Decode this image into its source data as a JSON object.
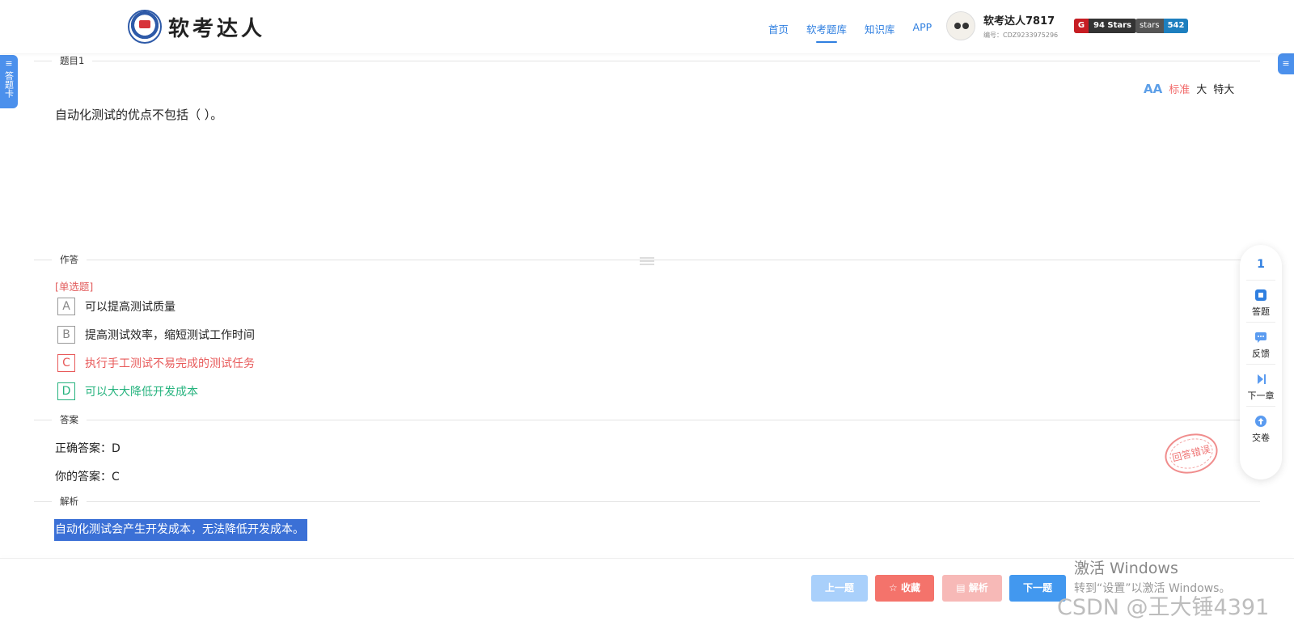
{
  "header": {
    "logo_text": "软考达人",
    "nav": [
      "首页",
      "软考题库",
      "知识库",
      "APP"
    ],
    "user_name": "软考达人7817",
    "user_id": "编号：CDZ9233975296",
    "gitee_badge": "94 Stars",
    "github_label": "stars",
    "github_count": "542"
  },
  "side_tab": {
    "label": "答题卡"
  },
  "sections": {
    "question": "题目1",
    "answer_area": "作答",
    "answer": "答案",
    "explanation": "解析"
  },
  "font_size": {
    "options": [
      "标准",
      "大",
      "特大"
    ],
    "selected": "标准"
  },
  "question": {
    "text": "自动化测试的优点不包括（ ）。",
    "type": "[单选题]"
  },
  "options": [
    {
      "letter": "A",
      "text": "可以提高测试质量",
      "state": "normal"
    },
    {
      "letter": "B",
      "text": "提高测试效率，缩短测试工作时间",
      "state": "normal"
    },
    {
      "letter": "C",
      "text": "执行手工测试不易完成的测试任务",
      "state": "wrong"
    },
    {
      "letter": "D",
      "text": "可以大大降低开发成本",
      "state": "correct"
    }
  ],
  "answer": {
    "correct_label": "正确答案：",
    "correct": "D",
    "yours_label": "你的答案：",
    "yours": "C",
    "stamp": "回答错误"
  },
  "explanation": {
    "text": "自动化测试会产生开发成本，无法降低开发成本。"
  },
  "float_panel": {
    "number": "1",
    "items": [
      {
        "label": "答题",
        "icon": "answer-sheet-icon"
      },
      {
        "label": "反馈",
        "icon": "feedback-icon"
      },
      {
        "label": "下一章",
        "icon": "next-chapter-icon"
      },
      {
        "label": "交卷",
        "icon": "submit-icon"
      }
    ]
  },
  "footer": {
    "prev": "上一题",
    "favorite": "☆ 收藏",
    "explain": "▤ 解析",
    "next": "下一题"
  },
  "watermark": {
    "line1": "激活 Windows",
    "line2": "转到“设置”以激活 Windows。",
    "csdn": "CSDN @王大锤4391"
  },
  "colors": {
    "primary": "#2f7fe0",
    "wrong": "#e85b5b",
    "correct": "#26b37e",
    "highlight": "#3b70d6"
  }
}
